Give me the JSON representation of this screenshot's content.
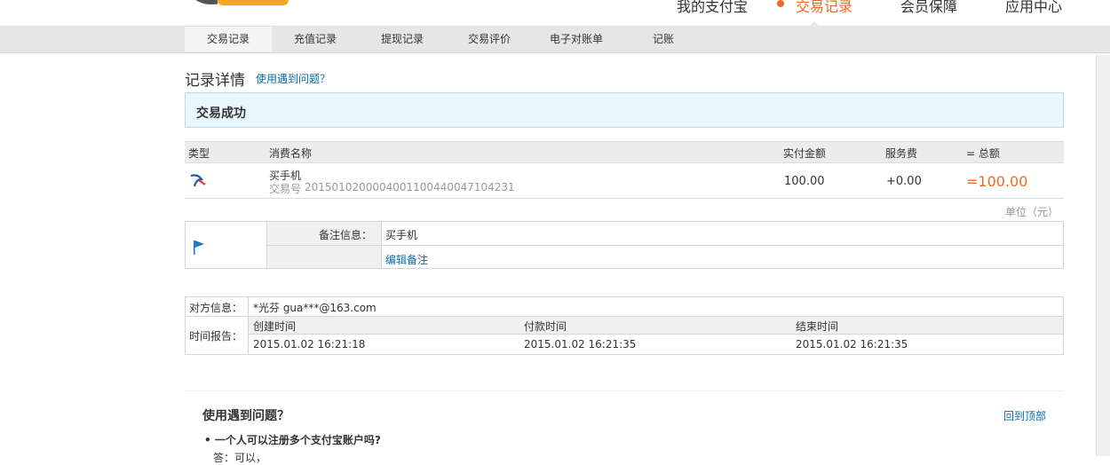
{
  "header": {
    "nav": [
      {
        "label": "我的支付宝"
      },
      {
        "label": "交易记录",
        "active": true
      },
      {
        "label": "会员保障"
      },
      {
        "label": "应用中心"
      }
    ]
  },
  "sub_nav": [
    {
      "label": "交易记录",
      "active": true
    },
    {
      "label": "充值记录"
    },
    {
      "label": "提现记录"
    },
    {
      "label": "交易评价"
    },
    {
      "label": "电子对账单"
    },
    {
      "label": "记账"
    }
  ],
  "page": {
    "title": "记录详情",
    "help_link": "使用遇到问题？"
  },
  "status": {
    "text": "交易成功",
    "banner_color": "#e9f6fd"
  },
  "trade_table": {
    "headers": {
      "type": "类型",
      "name": "消费名称",
      "paid": "实付金额",
      "fee": "服务费",
      "total": "= 总额"
    },
    "row": {
      "type_icon": "alipay-swallow-icon",
      "name": "买手机",
      "trade_no_label": "交易号",
      "trade_no": "2015010200004001100440047104231",
      "paid": "100.00",
      "fee": "+0.00",
      "total": "=100.00"
    },
    "unit_note": "单位（元）",
    "accent_color": "#f0691e"
  },
  "remark": {
    "flag_icon": "flag-icon",
    "label": "备注信息：",
    "value": "买手机",
    "edit_link": "编辑备注"
  },
  "counterparty": {
    "label": "对方信息：",
    "value": "*光芬 gua***@163.com"
  },
  "time_report": {
    "label": "时间报告：",
    "columns": [
      {
        "head": "创建时间",
        "value": "2015.01.02 16:21:18"
      },
      {
        "head": "付款时间",
        "value": "2015.01.02 16:21:35"
      },
      {
        "head": "结束时间",
        "value": "2015.01.02 16:21:35"
      }
    ]
  },
  "faq": {
    "title": "使用遇到问题？",
    "back_to_top": "回到顶部",
    "items": [
      {
        "q": "• 一个人可以注册多个支付宝账户吗?",
        "a": "答：可以，"
      }
    ]
  },
  "colors": {
    "link": "#0a6ea8",
    "accent": "#f0691e"
  }
}
